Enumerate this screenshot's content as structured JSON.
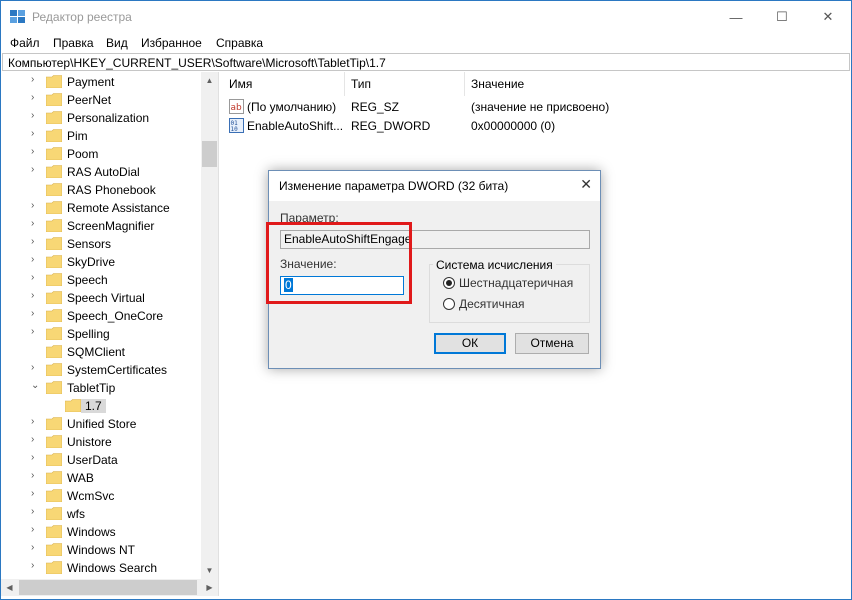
{
  "window": {
    "title": "Редактор реестра",
    "minimize": "—",
    "maximize": "☐",
    "close": "✕"
  },
  "menu": [
    "Файл",
    "Правка",
    "Вид",
    "Избранное",
    "Справка"
  ],
  "address": "Компьютер\\HKEY_CURRENT_USER\\Software\\Microsoft\\TabletTip\\1.7",
  "tree": [
    {
      "label": "Payment",
      "chev": "›"
    },
    {
      "label": "PeerNet",
      "chev": "›"
    },
    {
      "label": "Personalization",
      "chev": "›"
    },
    {
      "label": "Pim",
      "chev": "›"
    },
    {
      "label": "Poom",
      "chev": "›"
    },
    {
      "label": "RAS AutoDial",
      "chev": "›"
    },
    {
      "label": "RAS Phonebook",
      "chev": ""
    },
    {
      "label": "Remote Assistance",
      "chev": "›"
    },
    {
      "label": "ScreenMagnifier",
      "chev": "›"
    },
    {
      "label": "Sensors",
      "chev": "›"
    },
    {
      "label": "SkyDrive",
      "chev": "›"
    },
    {
      "label": "Speech",
      "chev": "›"
    },
    {
      "label": "Speech Virtual",
      "chev": "›"
    },
    {
      "label": "Speech_OneCore",
      "chev": "›"
    },
    {
      "label": "Spelling",
      "chev": "›"
    },
    {
      "label": "SQMClient",
      "chev": ""
    },
    {
      "label": "SystemCertificates",
      "chev": "›"
    },
    {
      "label": "TabletTip",
      "chev": "⌄"
    },
    {
      "label": "1.7",
      "chev": "",
      "selected": true
    },
    {
      "label": "Unified Store",
      "chev": "›"
    },
    {
      "label": "Unistore",
      "chev": "›"
    },
    {
      "label": "UserData",
      "chev": "›"
    },
    {
      "label": "WAB",
      "chev": "›"
    },
    {
      "label": "WcmSvc",
      "chev": "›"
    },
    {
      "label": "wfs",
      "chev": "›"
    },
    {
      "label": "Windows",
      "chev": "›"
    },
    {
      "label": "Windows NT",
      "chev": "›"
    },
    {
      "label": "Windows Search",
      "chev": "›"
    }
  ],
  "columns": {
    "name": "Имя",
    "type": "Тип",
    "value": "Значение"
  },
  "values": [
    {
      "icon": "string-value-icon",
      "name": "(По умолчанию)",
      "type": "REG_SZ",
      "data": "(значение не присвоено)"
    },
    {
      "icon": "binary-value-icon",
      "name": "EnableAutoShift...",
      "type": "REG_DWORD",
      "data": "0x00000000 (0)"
    }
  ],
  "dialog": {
    "title": "Изменение параметра DWORD (32 бита)",
    "close": "✕",
    "param_label": "Параметр:",
    "param_value": "EnableAutoShiftEngage",
    "value_label": "Значение:",
    "value_input": "0",
    "base_group": "Система исчисления",
    "radio_hex": "Шестнадцатеричная",
    "radio_dec": "Десятичная",
    "ok": "ОК",
    "cancel": "Отмена"
  },
  "colors": {
    "highlight": "#e0191a",
    "folder": "#f8d775",
    "accent": "#0078d7"
  }
}
